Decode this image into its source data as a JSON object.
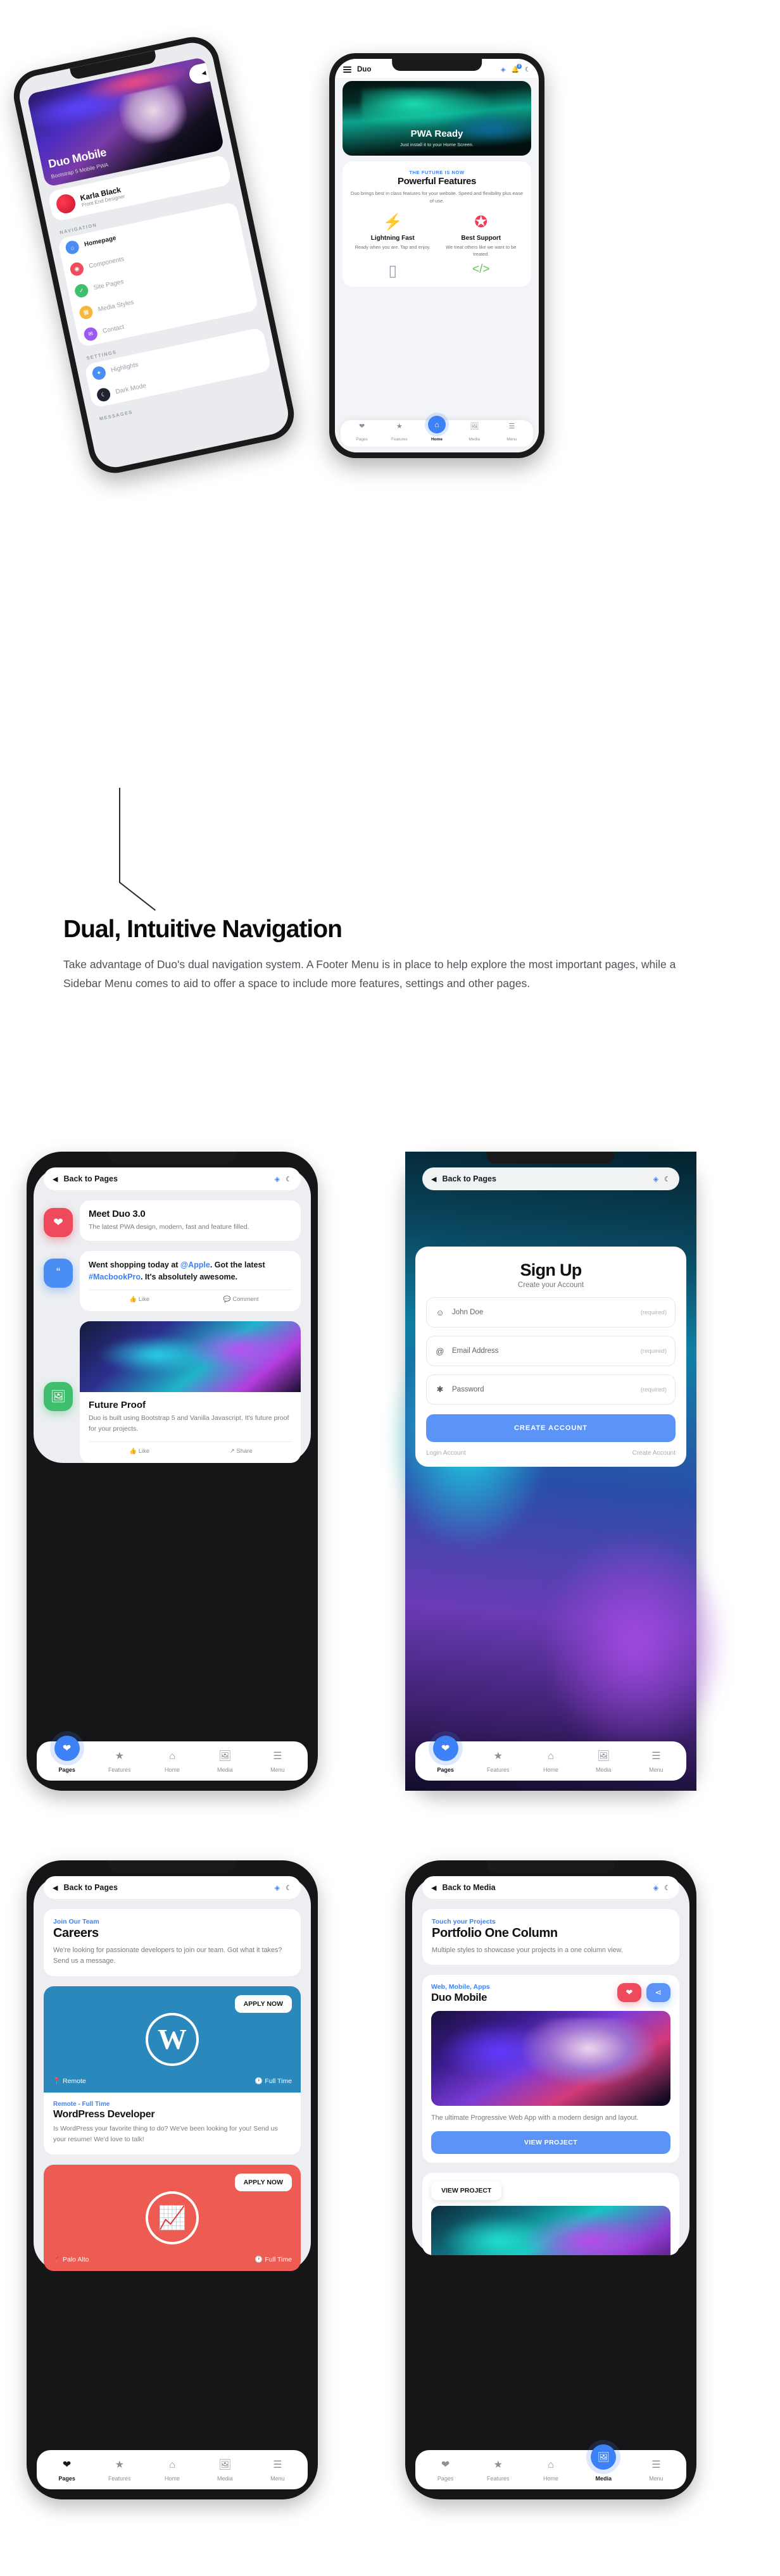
{
  "hero": {
    "back_phone": {
      "hero_card": {
        "title": "Duo Mobile",
        "subtitle": "Bootstrap 5 Mobile PWA",
        "pill_icon": "◀"
      },
      "profile": {
        "name": "Karla Black",
        "role": "Front End Designer"
      },
      "sections": [
        {
          "label": "NAVIGATION",
          "items": [
            {
              "label": "Homepage",
              "icon": "⌂",
              "color": "#4a8df3",
              "active": true
            },
            {
              "label": "Components",
              "icon": "◉",
              "color": "#ef4c5e",
              "active": false
            },
            {
              "label": "Site Pages",
              "icon": "✓",
              "color": "#3fbf6e",
              "active": false
            },
            {
              "label": "Media Styles",
              "icon": "▦",
              "color": "#f6b73c",
              "active": false
            },
            {
              "label": "Contact",
              "icon": "✉",
              "color": "#9b59f0",
              "active": false
            }
          ]
        },
        {
          "label": "SETTINGS",
          "items": [
            {
              "label": "Highlights",
              "icon": "✦",
              "color": "#4a8df3",
              "active": false
            },
            {
              "label": "Dark Mode",
              "icon": "☾",
              "color": "#1f2430",
              "active": false
            }
          ]
        },
        {
          "label": "MESSAGES",
          "items": []
        }
      ]
    },
    "front_phone": {
      "topbar": {
        "title": "Duo",
        "menu_icon": "hamburger-icon",
        "palette_icon": "◈",
        "bell_icon": "🔔",
        "bell_badge": "3",
        "moon_icon": "☾"
      },
      "hero_card": {
        "title": "PWA Ready",
        "subtitle": "Just install it to your Home Screen."
      },
      "features": {
        "eyebrow": "THE FUTURE IS NOW",
        "title": "Powerful Features",
        "paragraph": "Duo brings best in class features for your website. Speed and flexibility plus ease of use.",
        "items": [
          {
            "icon": "⚡",
            "color": "#f6b93b",
            "title": "Lightning Fast",
            "text": "Ready when you are. Tap and enjoy."
          },
          {
            "icon": "✪",
            "color": "#ee3e54",
            "title": "Best Support",
            "text": "We treat others like we want to be treated."
          },
          {
            "icon": "▯",
            "color": "#9aa3b0",
            "title": "",
            "text": ""
          },
          {
            "icon": "</>",
            "color": "#5fc94e",
            "title": "",
            "text": ""
          }
        ]
      },
      "tabs": [
        {
          "label": "Pages",
          "icon": "❤",
          "active": false
        },
        {
          "label": "Features",
          "icon": "★",
          "active": false
        },
        {
          "label": "Home",
          "icon": "⌂",
          "active": true
        },
        {
          "label": "Media",
          "icon": "🖼",
          "active": false
        },
        {
          "label": "Menu",
          "icon": "☰",
          "active": false
        }
      ]
    }
  },
  "textblock": {
    "heading": "Dual, Intuitive Navigation",
    "paragraph": "Take advantage of Duo's dual navigation system. A Footer Menu is in place to help explore the most important pages, while a Sidebar Menu comes to aid to offer a space to include more features, settings and  other pages."
  },
  "screen1": {
    "topbar": {
      "back_label": "Back to Pages",
      "back_icon": "◀",
      "palette_icon": "◈",
      "moon_icon": "☾"
    },
    "cards": [
      {
        "icon": "❤",
        "color": "#ee4a5c",
        "title": "Meet Duo 3.0",
        "text": "The latest PWA design, modern, fast and feature filled."
      }
    ],
    "tweet": {
      "icon": "“",
      "color": "#4a8df3",
      "parts": [
        {
          "t": "Went shopping today at ",
          "link": false
        },
        {
          "t": "@Apple",
          "link": true
        },
        {
          "t": ". Got the latest ",
          "link": false
        },
        {
          "t": "#MacbookPro",
          "link": true
        },
        {
          "t": ". It's absolutely awesome.",
          "link": false
        }
      ],
      "actions": [
        {
          "icon": "👍",
          "label": "Like"
        },
        {
          "icon": "💬",
          "label": "Comment"
        }
      ]
    },
    "media_card": {
      "icon": "🖼",
      "color": "#3fbf6e",
      "title": "Future Proof",
      "text": "Duo is built using Bootstrap 5 and Vanilla Javascript. It's future proof for your projects.",
      "actions": [
        {
          "icon": "👍",
          "label": "Like"
        },
        {
          "icon": "↗",
          "label": "Share"
        }
      ]
    },
    "tabs": [
      {
        "label": "Pages",
        "icon": "❤",
        "active": true
      },
      {
        "label": "Features",
        "icon": "★",
        "active": false
      },
      {
        "label": "Home",
        "icon": "⌂",
        "active": false
      },
      {
        "label": "Media",
        "icon": "🖼",
        "active": false
      },
      {
        "label": "Menu",
        "icon": "☰",
        "active": false
      }
    ]
  },
  "screen2": {
    "topbar": {
      "back_label": "Back to Pages",
      "back_icon": "◀",
      "palette_icon": "◈",
      "moon_icon": "☾"
    },
    "signup": {
      "title": "Sign Up",
      "subtitle": "Create your Account",
      "fields": [
        {
          "icon": "☺",
          "name": "name-field",
          "value": "John Doe",
          "required_label": "(required)"
        },
        {
          "icon": "@",
          "name": "email-field",
          "value": "Email Address",
          "required_label": "(required)"
        },
        {
          "icon": "✱",
          "name": "password-field",
          "value": "Password",
          "required_label": "(required)"
        }
      ],
      "submit_label": "CREATE ACCOUNT",
      "links": [
        "Login Account",
        "Create Account"
      ]
    },
    "tabs": [
      {
        "label": "Pages",
        "icon": "❤",
        "active": true
      },
      {
        "label": "Features",
        "icon": "★",
        "active": false
      },
      {
        "label": "Home",
        "icon": "⌂",
        "active": false
      },
      {
        "label": "Media",
        "icon": "🖼",
        "active": false
      },
      {
        "label": "Menu",
        "icon": "☰",
        "active": false
      }
    ]
  },
  "screen3": {
    "topbar": {
      "back_label": "Back to Pages",
      "back_icon": "◀",
      "palette_icon": "◈",
      "moon_icon": "☾"
    },
    "intro": {
      "eyebrow": "Join Our Team",
      "title": "Careers",
      "text": "We're looking for passionate developers to join our team. Got what it takes? Send us a message."
    },
    "jobs": [
      {
        "bg": "#2b88bd",
        "logo": "W",
        "logo_type": "wordpress",
        "apply_label": "APPLY NOW",
        "location": "Remote",
        "location_icon": "📍",
        "time": "Full Time",
        "time_icon": "🕐",
        "eyebrow": "Remote - Full Time",
        "title": "WordPress Developer",
        "text": "Is WordPress your favorite thing to do? We've been looking for you! Send us your resume! We'd love to talk!"
      },
      {
        "bg": "#ee5b52",
        "logo": "📈",
        "logo_type": "chart",
        "apply_label": "APPLY NOW",
        "location": "Palo Alto",
        "location_icon": "📍",
        "time": "Full Time",
        "time_icon": "🕐",
        "eyebrow": "",
        "title": "",
        "text": ""
      }
    ],
    "tabs": [
      {
        "label": "Pages",
        "icon": "❤",
        "active": true
      },
      {
        "label": "Features",
        "icon": "★",
        "active": false
      },
      {
        "label": "Home",
        "icon": "⌂",
        "active": false
      },
      {
        "label": "Media",
        "icon": "🖼",
        "active": false
      },
      {
        "label": "Menu",
        "icon": "☰",
        "active": false
      }
    ]
  },
  "screen4": {
    "topbar": {
      "back_label": "Back to Media",
      "back_icon": "◀",
      "palette_icon": "◈",
      "moon_icon": "☾"
    },
    "intro": {
      "eyebrow": "Touch your Projects",
      "title": "Portfolio One Column",
      "text": "Multiple styles to showcase your projects in a one column view."
    },
    "project": {
      "eyebrow": "Web, Mobile, Apps",
      "title": "Duo Mobile",
      "like_icon": "❤",
      "like_color": "#ee4a5c",
      "share_icon": "⋖",
      "share_color": "#5b93f7",
      "text": "The ultimate Progressive Web App with a modern design and layout.",
      "button_label": "VIEW PROJECT"
    },
    "project2": {
      "button_label": "VIEW PROJECT"
    },
    "tabs": [
      {
        "label": "Pages",
        "icon": "❤",
        "active": false
      },
      {
        "label": "Features",
        "icon": "★",
        "active": false
      },
      {
        "label": "Home",
        "icon": "⌂",
        "active": false
      },
      {
        "label": "Media",
        "icon": "🖼",
        "active": true
      },
      {
        "label": "Menu",
        "icon": "☰",
        "active": false
      }
    ]
  }
}
